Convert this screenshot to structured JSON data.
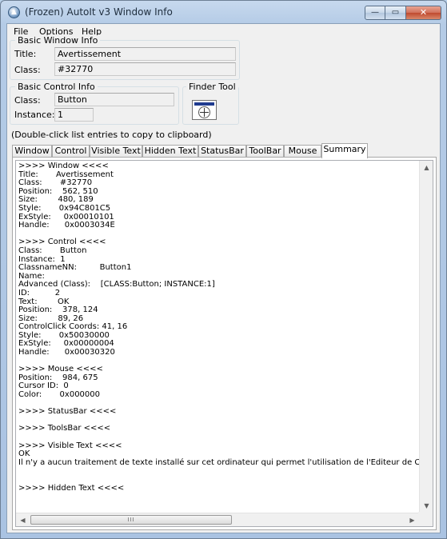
{
  "window": {
    "title": "(Frozen) AutoIt v3 Window Info",
    "controls": {
      "minimize": "—",
      "maximize": "▭",
      "close": "✕"
    }
  },
  "menu": [
    "File",
    "Options",
    "Help"
  ],
  "basic_window_info": {
    "legend": "Basic Window Info",
    "title_label": "Title:",
    "title_value": "Avertissement",
    "class_label": "Class:",
    "class_value": "#32770"
  },
  "basic_control_info": {
    "legend": "Basic Control Info",
    "class_label": "Class:",
    "class_value": "Button",
    "instance_label": "Instance:",
    "instance_value": "1"
  },
  "finder_tool": {
    "legend": "Finder Tool"
  },
  "hint": "(Double-click list entries to copy to clipboard)",
  "tabs": [
    "Window",
    "Control",
    "Visible Text",
    "Hidden Text",
    "StatusBar",
    "ToolBar",
    "Mouse",
    "Summary"
  ],
  "active_tab": "Summary",
  "summary_lines": [
    ">>>> Window <<<<",
    "Title:       Avertissement",
    "Class:       #32770",
    "Position:    562, 510",
    "Size:        480, 189",
    "Style:       0x94C801C5",
    "ExStyle:     0x00010101",
    "Handle:      0x0003034E",
    "",
    ">>>> Control <<<<",
    "Class:       Button",
    "Instance:  1",
    "ClassnameNN:         Button1",
    "Name:",
    "Advanced (Class):    [CLASS:Button; INSTANCE:1]",
    "ID:          2",
    "Text:        OK",
    "Position:    378, 124",
    "Size:        89, 26",
    "ControlClick Coords: 41, 16",
    "Style:       0x50030000",
    "ExStyle:     0x00000004",
    "Handle:      0x00030320",
    "",
    ">>>> Mouse <<<<",
    "Position:    984, 675",
    "Cursor ID:  0",
    "Color:       0x000000",
    "",
    ">>>> StatusBar <<<<",
    "",
    ">>>> ToolsBar <<<<",
    "",
    ">>>> Visible Text <<<<",
    "OK",
    "Il n'y a aucun traitement de texte installé sur cet ordinateur qui permet l'utilisation de l'Editeur de Correction e",
    "",
    "",
    ">>>> Hidden Text <<<<"
  ],
  "scrollbar": {
    "up": "▲",
    "down": "▼",
    "left": "◀",
    "right": "▶",
    "thumb_grip": "III"
  }
}
